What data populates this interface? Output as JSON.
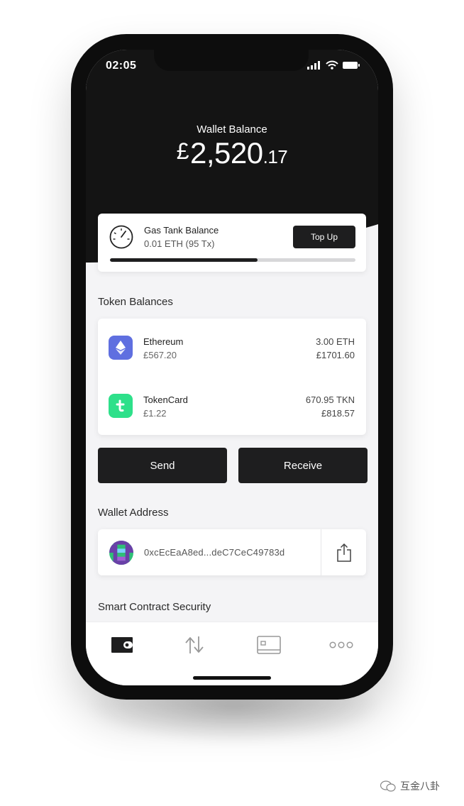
{
  "status_bar": {
    "time": "02:05"
  },
  "wallet": {
    "label": "Wallet Balance",
    "currency": "£",
    "integer": "2,520",
    "decimal": ".17"
  },
  "gas_tank": {
    "title": "Gas Tank Balance",
    "subtitle": "0.01 ETH (95 Tx)",
    "button_label": "Top Up",
    "progress_fraction": 0.6
  },
  "tokens": {
    "title": "Token Balances",
    "items": [
      {
        "name": "Ethereum",
        "fiat": "£567.20",
        "amount": "3.00 ETH",
        "value": "£1701.60",
        "icon": "ethereum-icon",
        "color": "#5f6fe0"
      },
      {
        "name": "TokenCard",
        "fiat": "£1.22",
        "amount": "670.95 TKN",
        "value": "£818.57",
        "icon": "tokencard-icon",
        "color": "#2ee08a"
      }
    ]
  },
  "actions": {
    "send_label": "Send",
    "receive_label": "Receive"
  },
  "address": {
    "title": "Wallet Address",
    "value": "0xcEcEaA8ed...deC7CeC49783d"
  },
  "security": {
    "title": "Smart Contract Security"
  },
  "tabs": [
    {
      "icon": "wallet-icon",
      "active": true
    },
    {
      "icon": "transfer-arrows-icon",
      "active": false
    },
    {
      "icon": "card-icon",
      "active": false
    },
    {
      "icon": "more-dots-icon",
      "active": false
    }
  ],
  "watermark": {
    "text": "互金八卦"
  },
  "colors": {
    "dark": "#141414",
    "button": "#1e1e1f",
    "background": "#f4f4f6"
  }
}
